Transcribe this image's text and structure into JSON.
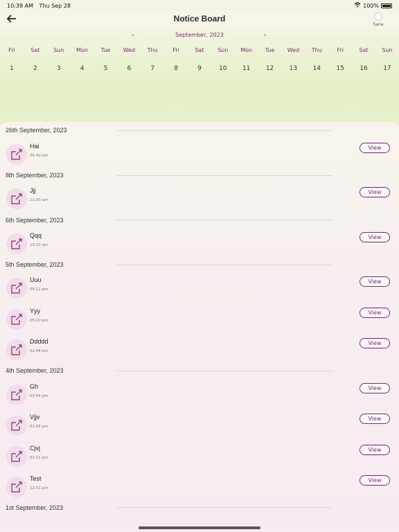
{
  "status": {
    "time": "10:39 AM",
    "date": "Thu Sep 28",
    "battery": "100%"
  },
  "header": {
    "title": "Notice Board",
    "back_icon": "arrow-left-icon",
    "profile_name": "Sana"
  },
  "calendar": {
    "month_label": "September, 2023",
    "prev_icon": "‹",
    "next_icon": "›",
    "days": [
      "Fri",
      "Sat",
      "Sun",
      "Mon",
      "Tue",
      "Wed",
      "Thu",
      "Fri",
      "Sat",
      "Sun",
      "Mon",
      "Tue",
      "Wed",
      "Thu",
      "Fri",
      "Sat",
      "Sun"
    ],
    "dates": [
      "1",
      "2",
      "3",
      "4",
      "5",
      "6",
      "7",
      "8",
      "9",
      "10",
      "11",
      "12",
      "13",
      "14",
      "15",
      "16",
      "17"
    ]
  },
  "sections": [
    {
      "date": "26th September, 2023",
      "items": [
        {
          "title": "Hai",
          "time": "05:40 pm"
        }
      ]
    },
    {
      "date": "8th September, 2023",
      "items": [
        {
          "title": "Jjj",
          "time": "11:00 am"
        }
      ]
    },
    {
      "date": "6th September, 2023",
      "items": [
        {
          "title": "Qqq",
          "time": "10:32 am"
        }
      ]
    },
    {
      "date": "5th September, 2023",
      "items": [
        {
          "title": "Uuu",
          "time": "05:12 pm"
        },
        {
          "title": "Yyy",
          "time": "05:10 pm"
        },
        {
          "title": "Ddddd",
          "time": "02:44 pm"
        }
      ]
    },
    {
      "date": "4th September, 2023",
      "items": [
        {
          "title": "Gh",
          "time": "03:04 pm"
        },
        {
          "title": "Vjjv",
          "time": "02:56 pm"
        },
        {
          "title": "Cjvj",
          "time": "02:21 pm"
        },
        {
          "title": "Test",
          "time": "12:51 pm"
        }
      ]
    },
    {
      "date": "1st September, 2023",
      "items": []
    }
  ],
  "view_label": "View",
  "colors": {
    "accent": "#7a2c6f",
    "icon_bg": "#f1dde8"
  }
}
